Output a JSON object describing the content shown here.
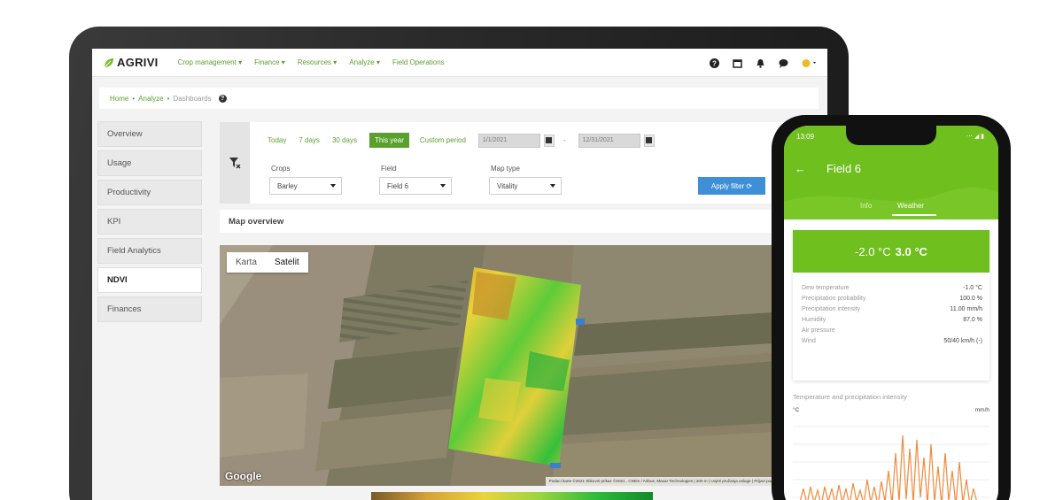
{
  "app": {
    "logo_text": "AGRIVI",
    "menu": [
      "Crop management ▾",
      "Finance ▾",
      "Resources ▾",
      "Analyze ▾",
      "Field Operations"
    ],
    "nav_icons": [
      "help-icon",
      "calendar-icon",
      "notification-bell-icon",
      "chat-icon",
      "user-menu-icon"
    ]
  },
  "breadcrumb": {
    "home": "Home",
    "analyze": "Analyze",
    "current": "Dashboards"
  },
  "sidebar": {
    "items": [
      {
        "label": "Overview",
        "active": false
      },
      {
        "label": "Usage",
        "active": false
      },
      {
        "label": "Productivity",
        "active": false
      },
      {
        "label": "KPI",
        "active": false
      },
      {
        "label": "Field Analytics",
        "active": false
      },
      {
        "label": "NDVI",
        "active": true
      },
      {
        "label": "Finances",
        "active": false
      }
    ]
  },
  "filter": {
    "periods": [
      "Today",
      "7 days",
      "30 days"
    ],
    "selected_period": "This year",
    "custom_period": "Custom period",
    "date_from": "1/1/2021",
    "date_to": "12/31/2021",
    "date_separator": "-",
    "crops_label": "Crops",
    "crops_value": "Barley",
    "field_label": "Field",
    "field_value": "Field 6",
    "maptype_label": "Map type",
    "maptype_value": "Vitality",
    "apply_label": "Apply filter ⟳"
  },
  "map": {
    "section_title": "Map overview",
    "tab_map": "Karta",
    "tab_satellite": "Satelit",
    "google_label": "Google",
    "attribution": "Podaci karte ©2021 Slikovni prikaz ©2021 , CNES / Airbus, Maxar Technologies | 200 m | Uvjeti pružanja usluge | Prijavi pogrešku"
  },
  "phone": {
    "time": "13:09",
    "status": "⋯ ◢ ▮",
    "back": "←",
    "title": "Field 6",
    "tab_info": "Info",
    "tab_weather": "Weather",
    "temp_min": "-2.0 °C",
    "temp_max": "3.0 °C",
    "weather_rows": [
      {
        "label": "Dew temperature",
        "value": "-1.0 °C"
      },
      {
        "label": "Precipitation probability",
        "value": "100.0 %"
      },
      {
        "label": "Precipitation intensity",
        "value": "11.00 mm/h"
      },
      {
        "label": "Humidity",
        "value": "87.0 %"
      },
      {
        "label": "Air pressure",
        "value": ""
      },
      {
        "label": "Wind",
        "value": "50/40 km/h (-)"
      }
    ],
    "chart_title": "Temperature and precipitation intensity",
    "unit_left": "°C",
    "unit_right": "mm/h"
  },
  "colors": {
    "brand_green": "#5aa02c",
    "phone_green": "#6fbf1e",
    "apply_blue": "#3f8fd6",
    "chart_orange": "#f08a3c"
  }
}
